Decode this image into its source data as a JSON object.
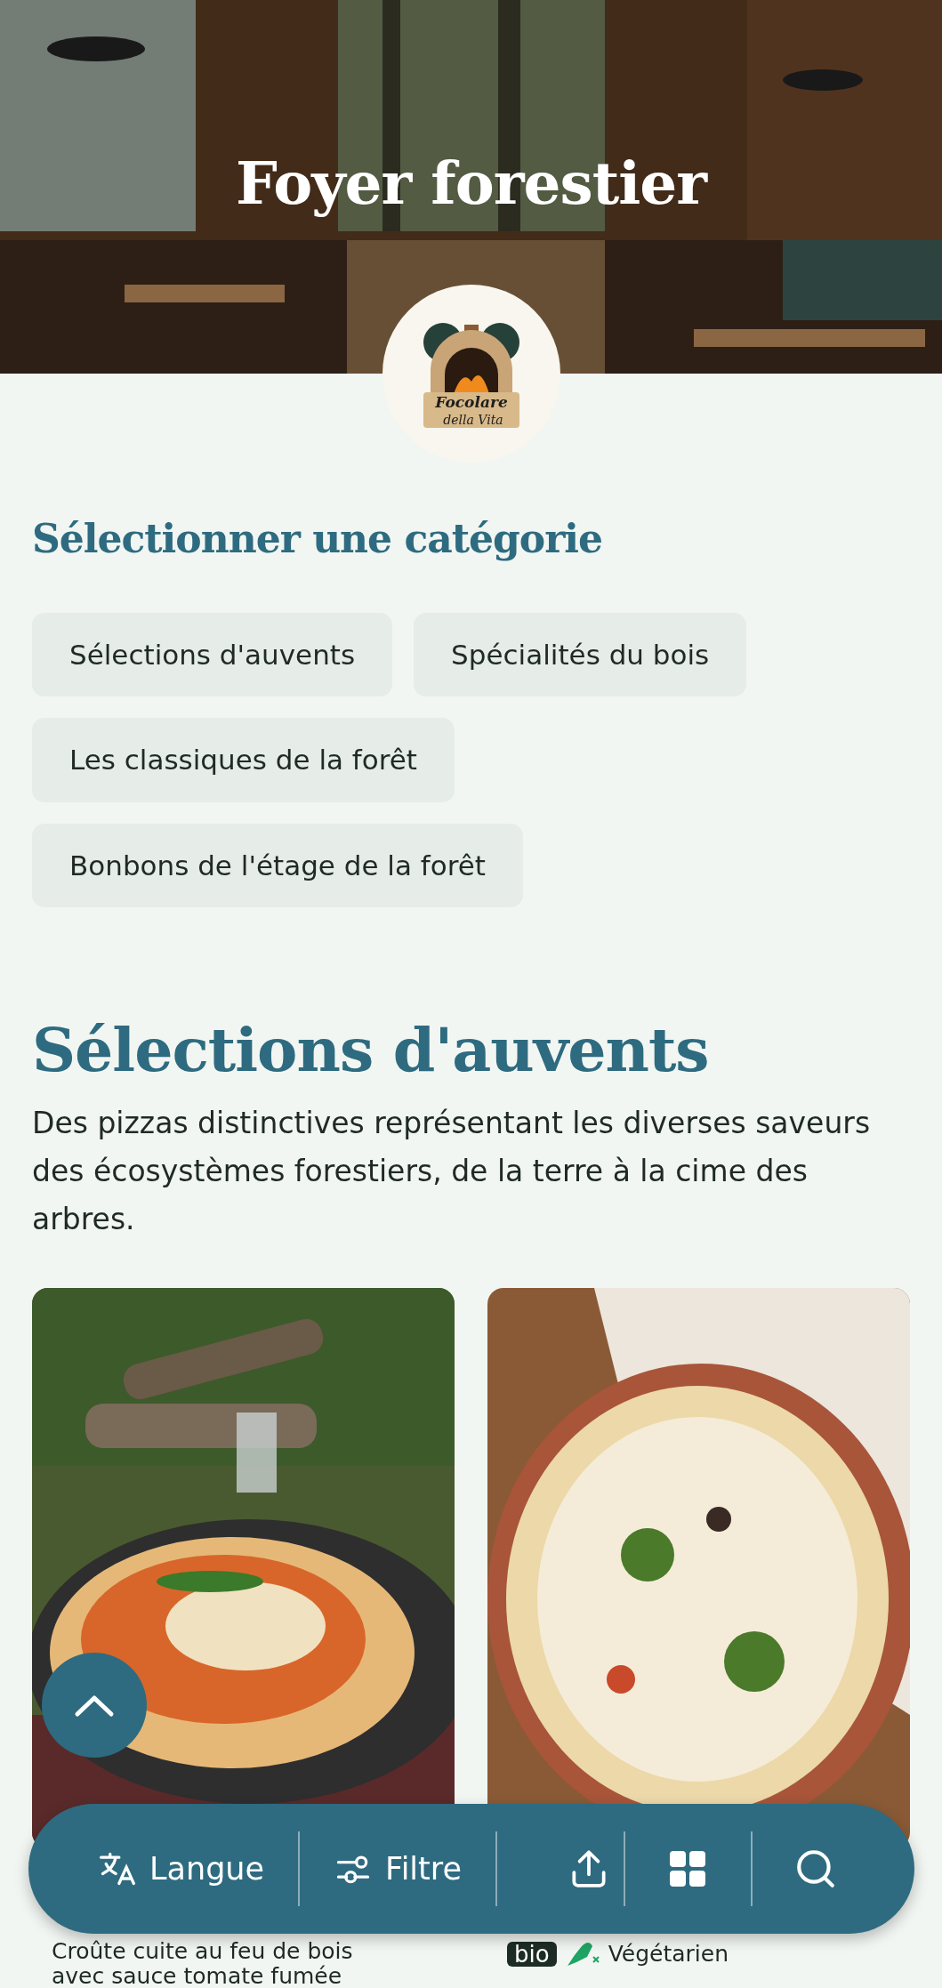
{
  "hero": {
    "title": "Foyer forestier",
    "logo": {
      "line1": "Focolare",
      "line2": "della Vita"
    }
  },
  "categories": {
    "heading": "Sélectionner une catégorie",
    "items": [
      {
        "label": "Sélections d'auvents"
      },
      {
        "label": "Spécialités du bois"
      },
      {
        "label": "Les classiques de la forêt"
      },
      {
        "label": "Bonbons de l'étage de la forêt"
      }
    ]
  },
  "section": {
    "title": "Sélections d'auvents",
    "description": "Des pizzas distinctives représentant les diverses saveurs des écosystèmes forestiers, de la terre à la cime des arbres.",
    "dishes": [
      {
        "kind": "picture",
        "description": "Croûte cuite au feu de bois avec sauce tomate fumée"
      },
      {
        "kind": "picture",
        "badge": "bio",
        "diet": "Végétarien"
      }
    ]
  },
  "toolbar": [
    {
      "kind": "language",
      "label": "Langue"
    },
    {
      "kind": "filter",
      "label": "Filtre"
    },
    {
      "kind": "share"
    },
    {
      "kind": "grid"
    },
    {
      "kind": "search"
    }
  ]
}
